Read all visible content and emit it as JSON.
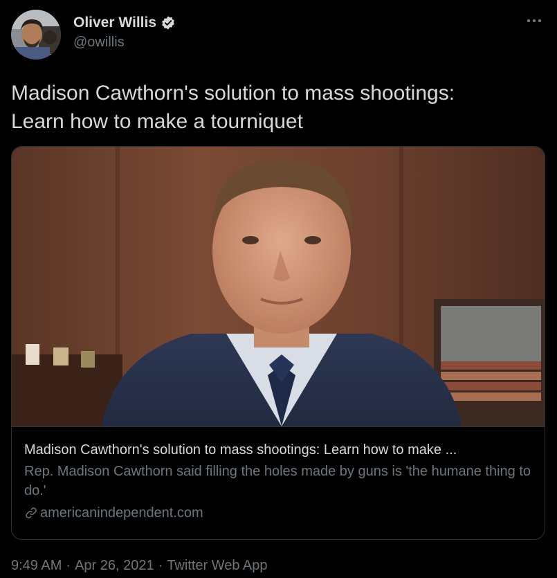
{
  "author": {
    "display_name": "Oliver Willis",
    "handle": "@owillis",
    "verified": true,
    "avatar_icon": "user-avatar"
  },
  "tweet": {
    "text_line1": "Madison Cawthorn's solution to mass shootings:",
    "text_line2": "Learn how to make a tourniquet"
  },
  "card": {
    "title": "Madison Cawthorn's solution to mass shootings: Learn how to make ...",
    "description": "Rep. Madison Cawthorn said filling the holes made by guns is 'the humane thing to do.'",
    "domain": "americanindependent.com",
    "image_icon": "news-photo"
  },
  "meta": {
    "time": "9:49 AM",
    "separator": "·",
    "date": "Apr 26, 2021",
    "source": "Twitter Web App"
  },
  "colors": {
    "background": "#000000",
    "primary_text": "#d9d9d9",
    "secondary_text": "#6e767d",
    "border": "#2f3336"
  }
}
